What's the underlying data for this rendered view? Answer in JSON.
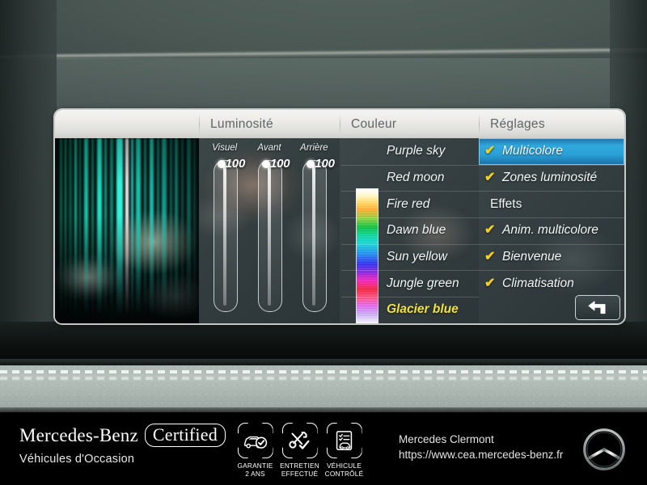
{
  "screen": {
    "columns": [
      {
        "header": "",
        "name": "preview"
      },
      {
        "header": "Luminosité",
        "name": "brightness"
      },
      {
        "header": "Couleur",
        "name": "color"
      },
      {
        "header": "Réglages",
        "name": "settings"
      }
    ],
    "brightness": {
      "sliders": [
        {
          "label": "Visuel",
          "value": "100"
        },
        {
          "label": "Avant",
          "value": "100"
        },
        {
          "label": "Arrière",
          "value": "100"
        }
      ]
    },
    "color": {
      "items": [
        {
          "label": "Purple sky",
          "active": false
        },
        {
          "label": "Red moon",
          "active": false
        },
        {
          "label": "Fire red",
          "active": false
        },
        {
          "label": "Dawn blue",
          "active": false
        },
        {
          "label": "Sun yellow",
          "active": false
        },
        {
          "label": "Jungle green",
          "active": false
        },
        {
          "label": "Glacier blue",
          "active": true
        }
      ],
      "active_color_text": "#f3e23d"
    },
    "settings": {
      "items": [
        {
          "label": "Multicolore",
          "checked": true,
          "selected": true,
          "is_header": false
        },
        {
          "label": "Zones luminosité",
          "checked": true,
          "selected": false,
          "is_header": false
        },
        {
          "label": "Effets",
          "checked": false,
          "selected": false,
          "is_header": true
        },
        {
          "label": "Anim. multicolore",
          "checked": true,
          "selected": false,
          "is_header": false
        },
        {
          "label": "Bienvenue",
          "checked": true,
          "selected": false,
          "is_header": false
        },
        {
          "label": "Climatisation",
          "checked": true,
          "selected": false,
          "is_header": false
        }
      ],
      "check_glyph": "✔",
      "check_color": "#f5d215",
      "selection_color": "#2fa8dd",
      "back_button_icon": "back-arrow-icon"
    }
  },
  "banner": {
    "brand": "Mercedes-Benz",
    "certified": "Certified",
    "subtitle": "Véhicules d'Occasion",
    "badges": [
      {
        "icon": "car-check-icon",
        "line1": "GARANTIE",
        "line2": "2 ANS"
      },
      {
        "icon": "tools-check-icon",
        "line1": "ENTRETIEN",
        "line2": "EFFECTUÉ"
      },
      {
        "icon": "checklist-car-icon",
        "line1": "VÉHICULE",
        "line2": "CONTRÔLÉ"
      }
    ],
    "dealer_name": "Mercedes Clermont",
    "dealer_url": "https://www.cea.mercedes-benz.fr",
    "logo": "mercedes-star-logo"
  }
}
